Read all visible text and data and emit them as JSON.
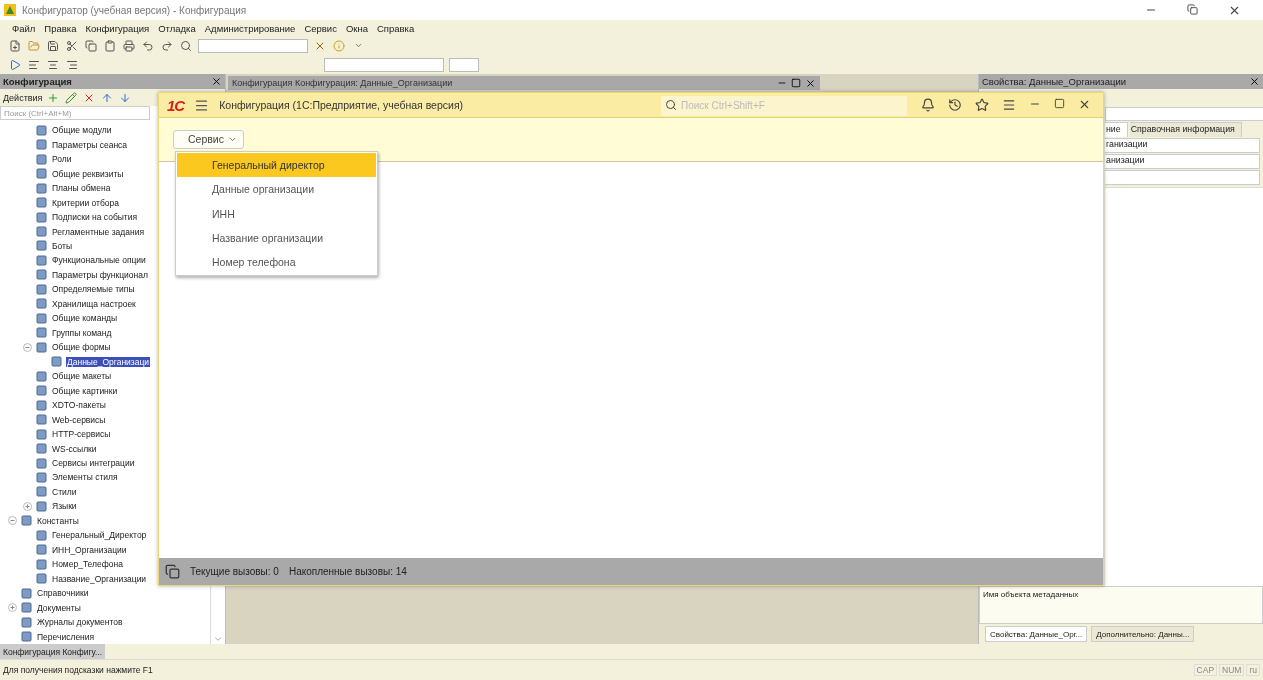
{
  "window": {
    "title": "Конфигуратор (учебная версия) - Конфигурация"
  },
  "menu": [
    "Файл",
    "Правка",
    "Конфигурация",
    "Отладка",
    "Администрирование",
    "Сервис",
    "Окна",
    "Справка"
  ],
  "config_panel": {
    "title": "Конфигурация",
    "actions_label": "Действия",
    "search": {
      "placeholder": "Поиск (Ctrl+Alt+M)"
    },
    "tree": {
      "continued_items": [
        {
          "label": "Общие модули",
          "selected": false
        },
        {
          "label": "Параметры сеанса",
          "selected": false
        },
        {
          "label": "Роли",
          "selected": false
        },
        {
          "label": "Общие реквизиты",
          "selected": false
        },
        {
          "label": "Планы обмена",
          "selected": false
        },
        {
          "label": "Критерии отбора",
          "selected": false
        },
        {
          "label": "Подписки на события",
          "selected": false
        },
        {
          "label": "Регламентные задания",
          "selected": false
        },
        {
          "label": "Боты",
          "selected": false
        },
        {
          "label": "Функциональные опции",
          "selected": false
        },
        {
          "label": "Параметры функционал",
          "selected": false
        },
        {
          "label": "Определяемые типы",
          "selected": false
        },
        {
          "label": "Хранилища настроек",
          "selected": false
        },
        {
          "label": "Общие команды",
          "selected": false
        },
        {
          "label": "Группы команд",
          "selected": false
        },
        {
          "label": "Общие формы",
          "selected": false,
          "expanded": true,
          "children": [
            {
              "label": "Данные_Организаци",
              "selected": true
            }
          ]
        },
        {
          "label": "Общие макеты",
          "selected": false
        },
        {
          "label": "Общие картинки",
          "selected": false
        },
        {
          "label": "XDTO-пакеты",
          "selected": false
        },
        {
          "label": "Web-сервисы",
          "selected": false
        },
        {
          "label": "HTTP-сервисы",
          "selected": false
        },
        {
          "label": "WS-ссылки",
          "selected": false
        },
        {
          "label": "Сервисы интеграции",
          "selected": false
        },
        {
          "label": "Элементы стиля",
          "selected": false
        },
        {
          "label": "Стили",
          "selected": false
        },
        {
          "label": "Языки",
          "selected": false,
          "expanded": false
        }
      ],
      "items": [
        {
          "label": "Константы",
          "selected": false,
          "expanded": true,
          "children": [
            {
              "label": "Генеральный_Директор",
              "selected": false
            },
            {
              "label": "ИНН_Организации",
              "selected": false
            },
            {
              "label": "Номер_Телефона",
              "selected": false
            },
            {
              "label": "Название_Организации",
              "selected": false
            }
          ]
        },
        {
          "label": "Справочники",
          "selected": false
        },
        {
          "label": "Документы",
          "selected": false,
          "expanded": false
        },
        {
          "label": "Журналы документов",
          "selected": false
        },
        {
          "label": "Перечисления",
          "selected": false
        }
      ]
    }
  },
  "child_window": {
    "title": "Конфигурация Конфигурация: Данные_Организации"
  },
  "properties_panel": {
    "title": "Свойства: Данные_Организации",
    "tabs": [
      {
        "label": "ние",
        "selected": true
      },
      {
        "label": "Справочная информация",
        "selected": false
      }
    ],
    "rows": [
      "ганизации",
      "анизации"
    ],
    "description": "Имя объекта метаданных",
    "bottom_tabs": [
      {
        "label": "Свойства: Данные_Орг...",
        "selected": true
      },
      {
        "label": "Дополнительно: Данны...",
        "selected": false
      }
    ]
  },
  "app_window": {
    "logo": "1С",
    "title": "Конфигурация  (1С:Предприятие, учебная версия)",
    "search": {
      "placeholder": "Поиск Ctrl+Shift+F"
    },
    "command": "Сервис",
    "menu_items": [
      {
        "label": "Генеральный директор",
        "selected": true
      },
      {
        "label": "Данные организации",
        "selected": false
      },
      {
        "label": "ИНН",
        "selected": false
      },
      {
        "label": "Название организации",
        "selected": false
      },
      {
        "label": "Номер телефона",
        "selected": false
      }
    ],
    "footer": [
      "Текущие вызовы: 0",
      "Накопленные вызовы: 14"
    ]
  },
  "taskbar": [
    "Конфигурация Конфигу..."
  ],
  "status_bar": {
    "hint": "Для получения подсказки нажмите F1",
    "indicators": [
      "CAP",
      "NUM",
      "ru"
    ]
  }
}
